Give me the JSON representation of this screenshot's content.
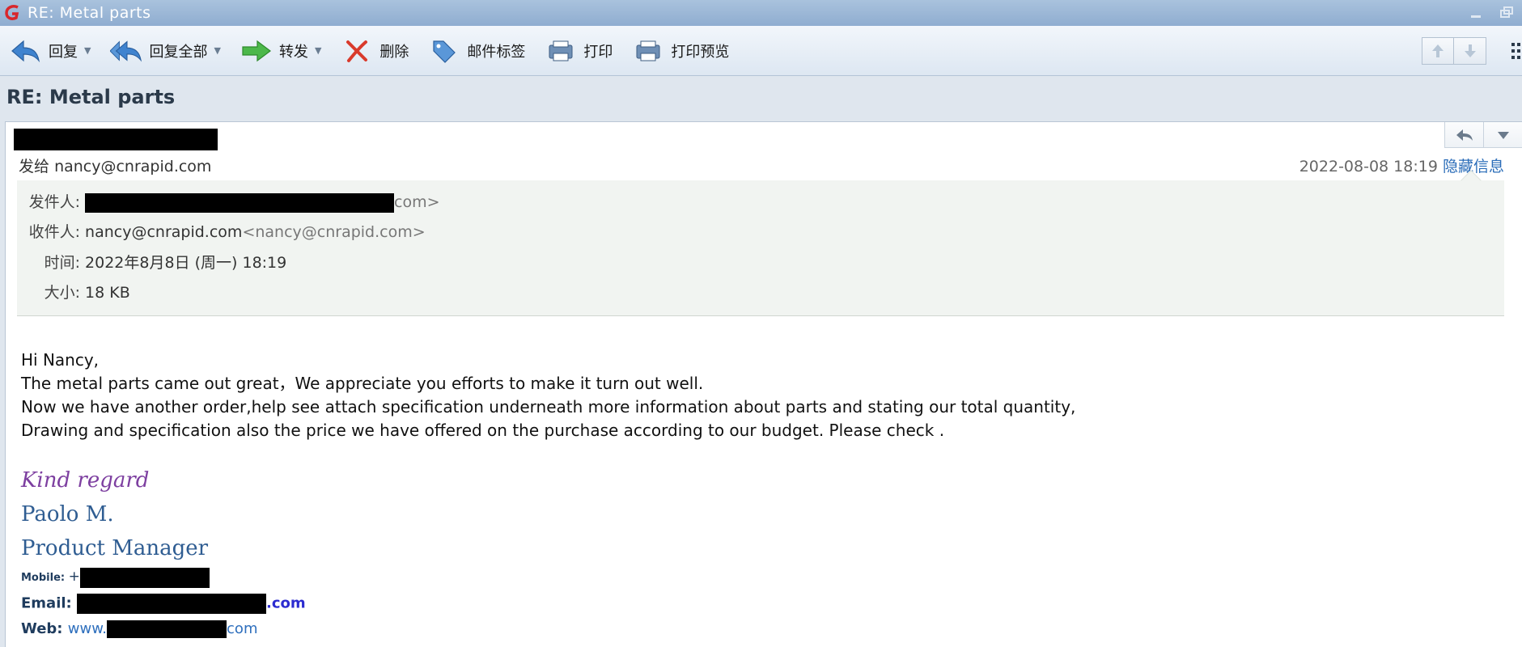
{
  "window": {
    "title": "RE:  Metal parts"
  },
  "toolbar": {
    "buttons": [
      {
        "label": "回复",
        "icon": "reply-icon",
        "has_menu": true
      },
      {
        "label": "回复全部",
        "icon": "reply-all-icon",
        "has_menu": true
      },
      {
        "label": "转发",
        "icon": "forward-icon",
        "has_menu": true
      },
      {
        "label": "删除",
        "icon": "delete-icon",
        "has_menu": false
      },
      {
        "label": "邮件标签",
        "icon": "tag-icon",
        "has_menu": false
      },
      {
        "label": "打印",
        "icon": "print-icon",
        "has_menu": false
      },
      {
        "label": "打印预览",
        "icon": "print-preview-icon",
        "has_menu": false
      }
    ]
  },
  "mail": {
    "subject": "RE:  Metal parts",
    "to_prefix": "发给",
    "to_address": "nancy@cnrapid.com",
    "date_short": "2022-08-08  18:19",
    "hide_info_link": "隐藏信息",
    "details": {
      "from_label": "发件人:",
      "from_tail": "com>",
      "to_label": "收件人:",
      "to_name": "nancy@cnrapid.com",
      "to_addr": "<nancy@cnrapid.com>",
      "time_label": "时间:",
      "time_value": "2022年8月8日 (周一) 18:19",
      "size_label": "大小:",
      "size_value": "18 KB"
    },
    "body": [
      "Hi Nancy,",
      "The metal parts came out great，We appreciate you efforts to make it turn out well.",
      "Now we have another order,help see attach specification underneath more information about parts and stating our total quantity,",
      "Drawing and specification also the price we have offered on the purchase according to our budget. Please check ."
    ],
    "signature": {
      "closing": "Kind regard",
      "name": "Paolo M.",
      "title": "Product Manager",
      "mobile_label": "Mobile:",
      "mobile_prefix": "+",
      "email_label": "Email:",
      "email_tail": ".com",
      "web_label": "Web:",
      "web_prefix": "www.",
      "web_tail": "com"
    }
  }
}
